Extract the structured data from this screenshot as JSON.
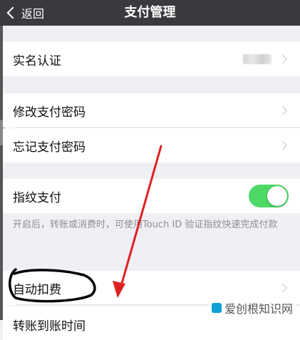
{
  "navbar": {
    "back_label": "返回",
    "title": "支付管理"
  },
  "rows": {
    "real_name": {
      "label": "实名认证"
    },
    "change_password": {
      "label": "修改支付密码"
    },
    "forgot_password": {
      "label": "忘记支付密码"
    },
    "fingerprint": {
      "label": "指纹支付",
      "enabled": true
    },
    "auto_deduct": {
      "label": "自动扣费"
    },
    "transfer_time": {
      "label": "转账到账时间"
    }
  },
  "fingerprint_hint": "开启后，转账或消费时，可使用Touch ID 验证指纹快速完成付款",
  "watermark": {
    "text": "爱创根知识网"
  },
  "colors": {
    "navbar": "#393a3f",
    "toggle_on": "#4cd964",
    "arrow": "#e02020",
    "scribble": "#000000"
  }
}
